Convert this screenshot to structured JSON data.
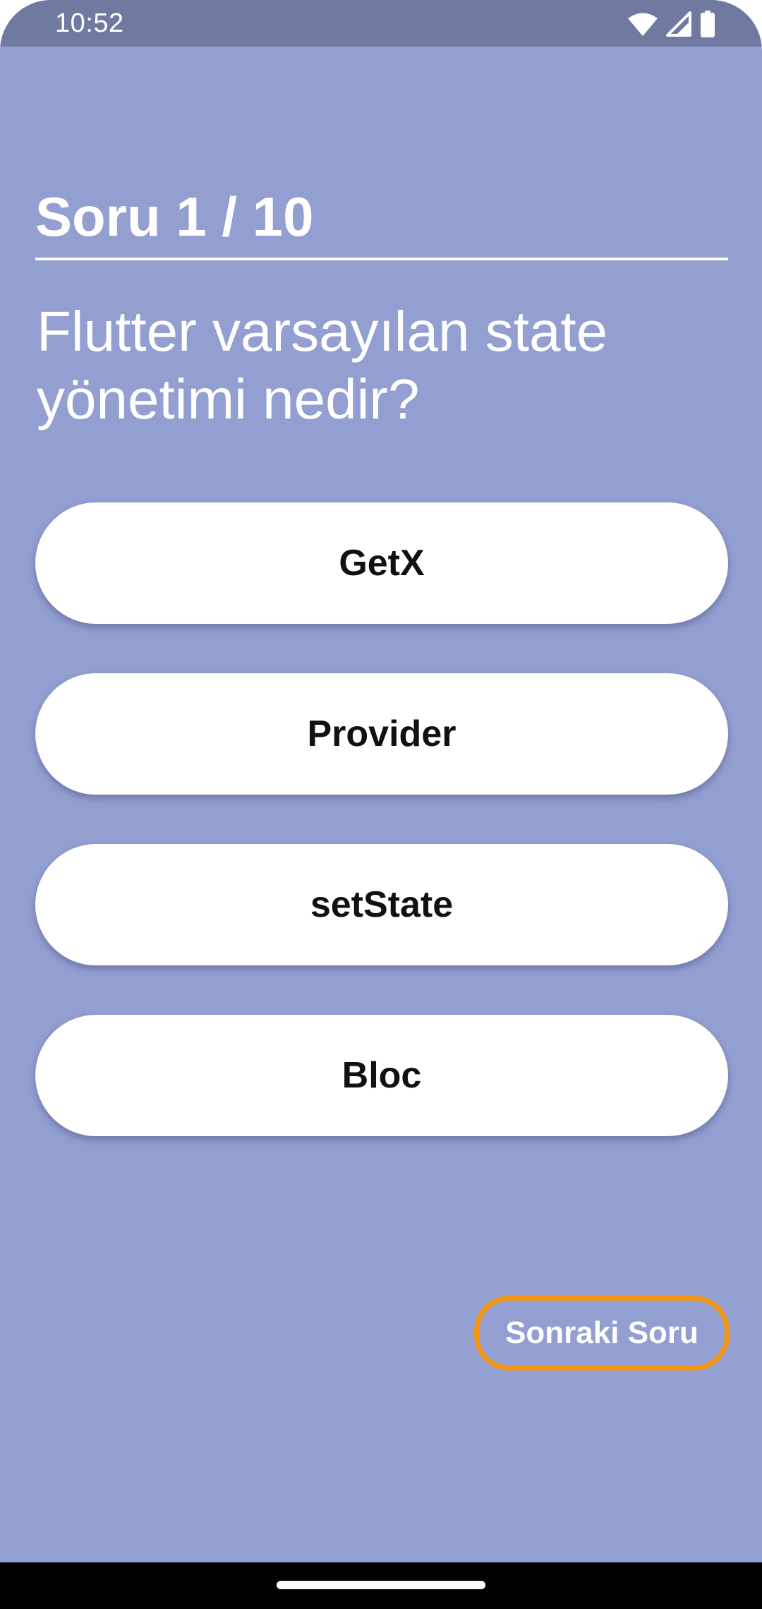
{
  "status_bar": {
    "time": "10:52",
    "icons": [
      "wifi-icon",
      "signal-icon",
      "battery-icon"
    ]
  },
  "quiz": {
    "progress_title": "Soru 1 / 10",
    "question": "Flutter varsayılan state yönetimi nedir?",
    "answers": [
      "GetX",
      "Provider",
      "setState",
      "Bloc"
    ],
    "next_button": "Sonraki Soru"
  },
  "colors": {
    "background": "#939ed1",
    "status_bar": "#7079a0",
    "answer_background": "#ffffff",
    "next_button_border": "#f5940f"
  }
}
